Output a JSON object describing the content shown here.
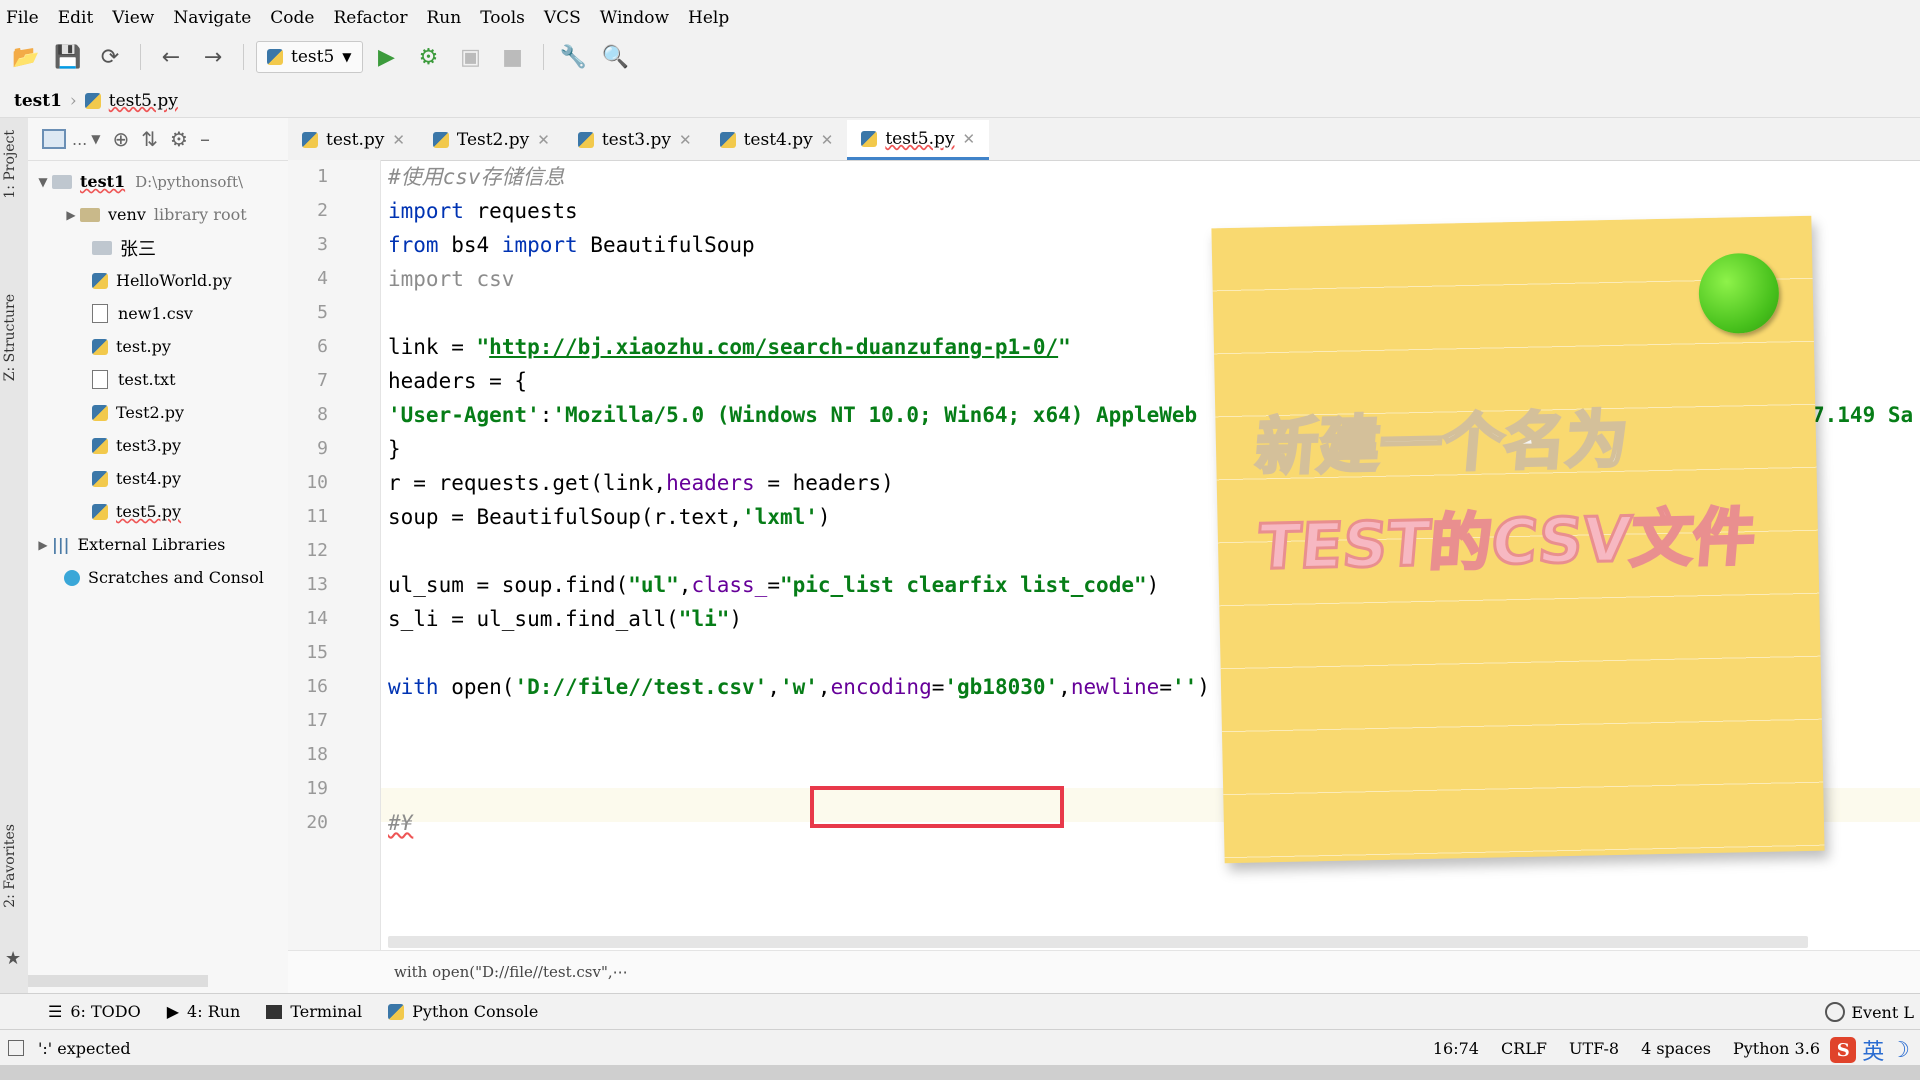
{
  "menu": [
    "File",
    "Edit",
    "View",
    "Navigate",
    "Code",
    "Refactor",
    "Run",
    "Tools",
    "VCS",
    "Window",
    "Help"
  ],
  "toolbar": {
    "run_config": "test5"
  },
  "breadcrumb": {
    "project": "test1",
    "file": "test5.py"
  },
  "side_labels": {
    "project": "1: Project",
    "structure": "Z: Structure",
    "favorites": "2: Favorites"
  },
  "project_tree": {
    "toolbar_dots": "...",
    "root": {
      "name": "test1",
      "path": "D:\\pythonsoft\\"
    },
    "venv": {
      "name": "venv",
      "note": "library root"
    },
    "items": [
      "张三",
      "HelloWorld.py",
      "new1.csv",
      "test.py",
      "test.txt",
      "Test2.py",
      "test3.py",
      "test4.py",
      "test5.py"
    ],
    "external": "External Libraries",
    "scratches": "Scratches and Consol"
  },
  "tabs": [
    {
      "label": "test.py"
    },
    {
      "label": "Test2.py"
    },
    {
      "label": "test3.py"
    },
    {
      "label": "test4.py"
    },
    {
      "label": "test5.py",
      "active": true
    }
  ],
  "code": {
    "line_numbers": [
      "1",
      "2",
      "3",
      "4",
      "5",
      "6",
      "7",
      "8",
      "9",
      "10",
      "11",
      "12",
      "13",
      "14",
      "15",
      "16",
      "17",
      "18",
      "19",
      "20"
    ],
    "l1": "#使用csv存储信息",
    "l2_kw": "import",
    "l2_rest": " requests",
    "l3_kw1": "from",
    "l3_mid": " bs4 ",
    "l3_kw2": "import",
    "l3_rest": " BeautifulSoup",
    "l4": "import csv",
    "l6_pre": "link = ",
    "l6_q1": "\"",
    "l6_url": "http://bj.xiaozhu.com/search-duanzufang-p1-0/",
    "l6_q2": "\"",
    "l7": "headers = {",
    "l8_key": "'User-Agent'",
    "l8_colon": ":",
    "l8_val": "'Mozilla/5.0 (Windows NT 10.0; Win64; x64) AppleWeb",
    "l8_tail": "7.149 Sa",
    "l9": "}",
    "l10_pre": "r = requests.get(link,",
    "l10_param": "headers",
    "l10_rest": " = headers)",
    "l11_pre": "soup = BeautifulSoup(r.text,",
    "l11_str": "'lxml'",
    "l11_end": ")",
    "l13_pre": "ul_sum = soup.find(",
    "l13_s1": "\"ul\"",
    "l13_comma": ",",
    "l13_param": "class_",
    "l13_eq": "=",
    "l13_s2": "\"pic_list clearfix list_code\"",
    "l13_end": ")",
    "l14_pre": "s_li = ul_sum.find_all(",
    "l14_s": "\"li\"",
    "l14_end": ")",
    "l16_kw": "with",
    "l16_open": " open(",
    "l16_path": "'D://file//test.csv'",
    "l16_c1": ",",
    "l16_w": "'w'",
    "l16_c2": ",",
    "l16_enc": "encoding",
    "l16_eq1": "=",
    "l16_gb": "'gb18030'",
    "l16_c3": ",",
    "l16_nl": "newline",
    "l16_eq2": "=",
    "l16_empty": "''",
    "l16_end": ")",
    "l20": "#¥"
  },
  "hint": "with open(\"D://file//test.csv\",⋯",
  "bottom_tools": {
    "todo": "6: TODO",
    "run": "4: Run",
    "terminal": "Terminal",
    "console": "Python Console",
    "event": "Event L"
  },
  "status": {
    "message": "':' expected",
    "position": "16:74",
    "line_sep": "CRLF",
    "encoding": "UTF-8",
    "indent": "4 spaces",
    "interpreter": "Python 3.6",
    "ime_lang": "英"
  },
  "sticky_note": {
    "line1": "新建一个名为",
    "line2": "TEST的CSV文件",
    "paper_color": "#f9d970",
    "pin_color": "#47c01c"
  },
  "colors": {
    "keyword": "#0033b3",
    "string": "#067d17",
    "param": "#660099",
    "highlight_box": "#e8394a",
    "active_tab": "#4083c9"
  }
}
